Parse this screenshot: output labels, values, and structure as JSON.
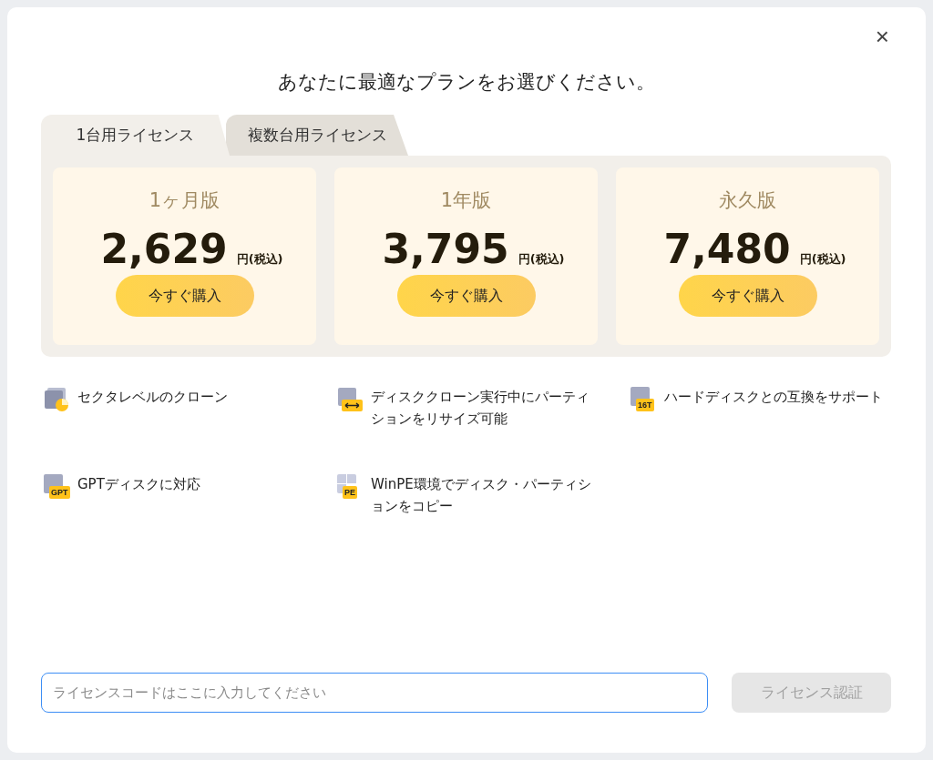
{
  "dialog": {
    "title": "あなたに最適なプランをお選びください。",
    "close": "×"
  },
  "tabs": [
    {
      "label": "1台用ライセンス",
      "selected": true
    },
    {
      "label": "複数台用ライセンス",
      "selected": false
    }
  ],
  "plans": [
    {
      "name": "1ヶ月版",
      "price": "2,629",
      "unit": "円(税込)",
      "button": "今すぐ購入"
    },
    {
      "name": "1年版",
      "price": "3,795",
      "unit": "円(税込)",
      "button": "今すぐ購入"
    },
    {
      "name": "永久版",
      "price": "7,480",
      "unit": "円(税込)",
      "button": "今すぐ購入"
    }
  ],
  "features": [
    {
      "kind": "pie",
      "text": "セクタレベルのクローン"
    },
    {
      "kind": "arrows",
      "text": "ディスククローン実行中にパーティションをリサイズ可能"
    },
    {
      "kind": "badge",
      "badge": "16T",
      "text": "ハードディスクとの互換をサポート"
    },
    {
      "kind": "badge",
      "badge": "GPT",
      "text": "GPTディスクに対応"
    },
    {
      "kind": "windows",
      "badge": "PE",
      "text": "WinPE環境でディスク・パーティションをコピー"
    }
  ],
  "license": {
    "placeholder": "ライセンスコードはここに入力してください",
    "button": "ライセンス認証",
    "button_disabled": true
  }
}
